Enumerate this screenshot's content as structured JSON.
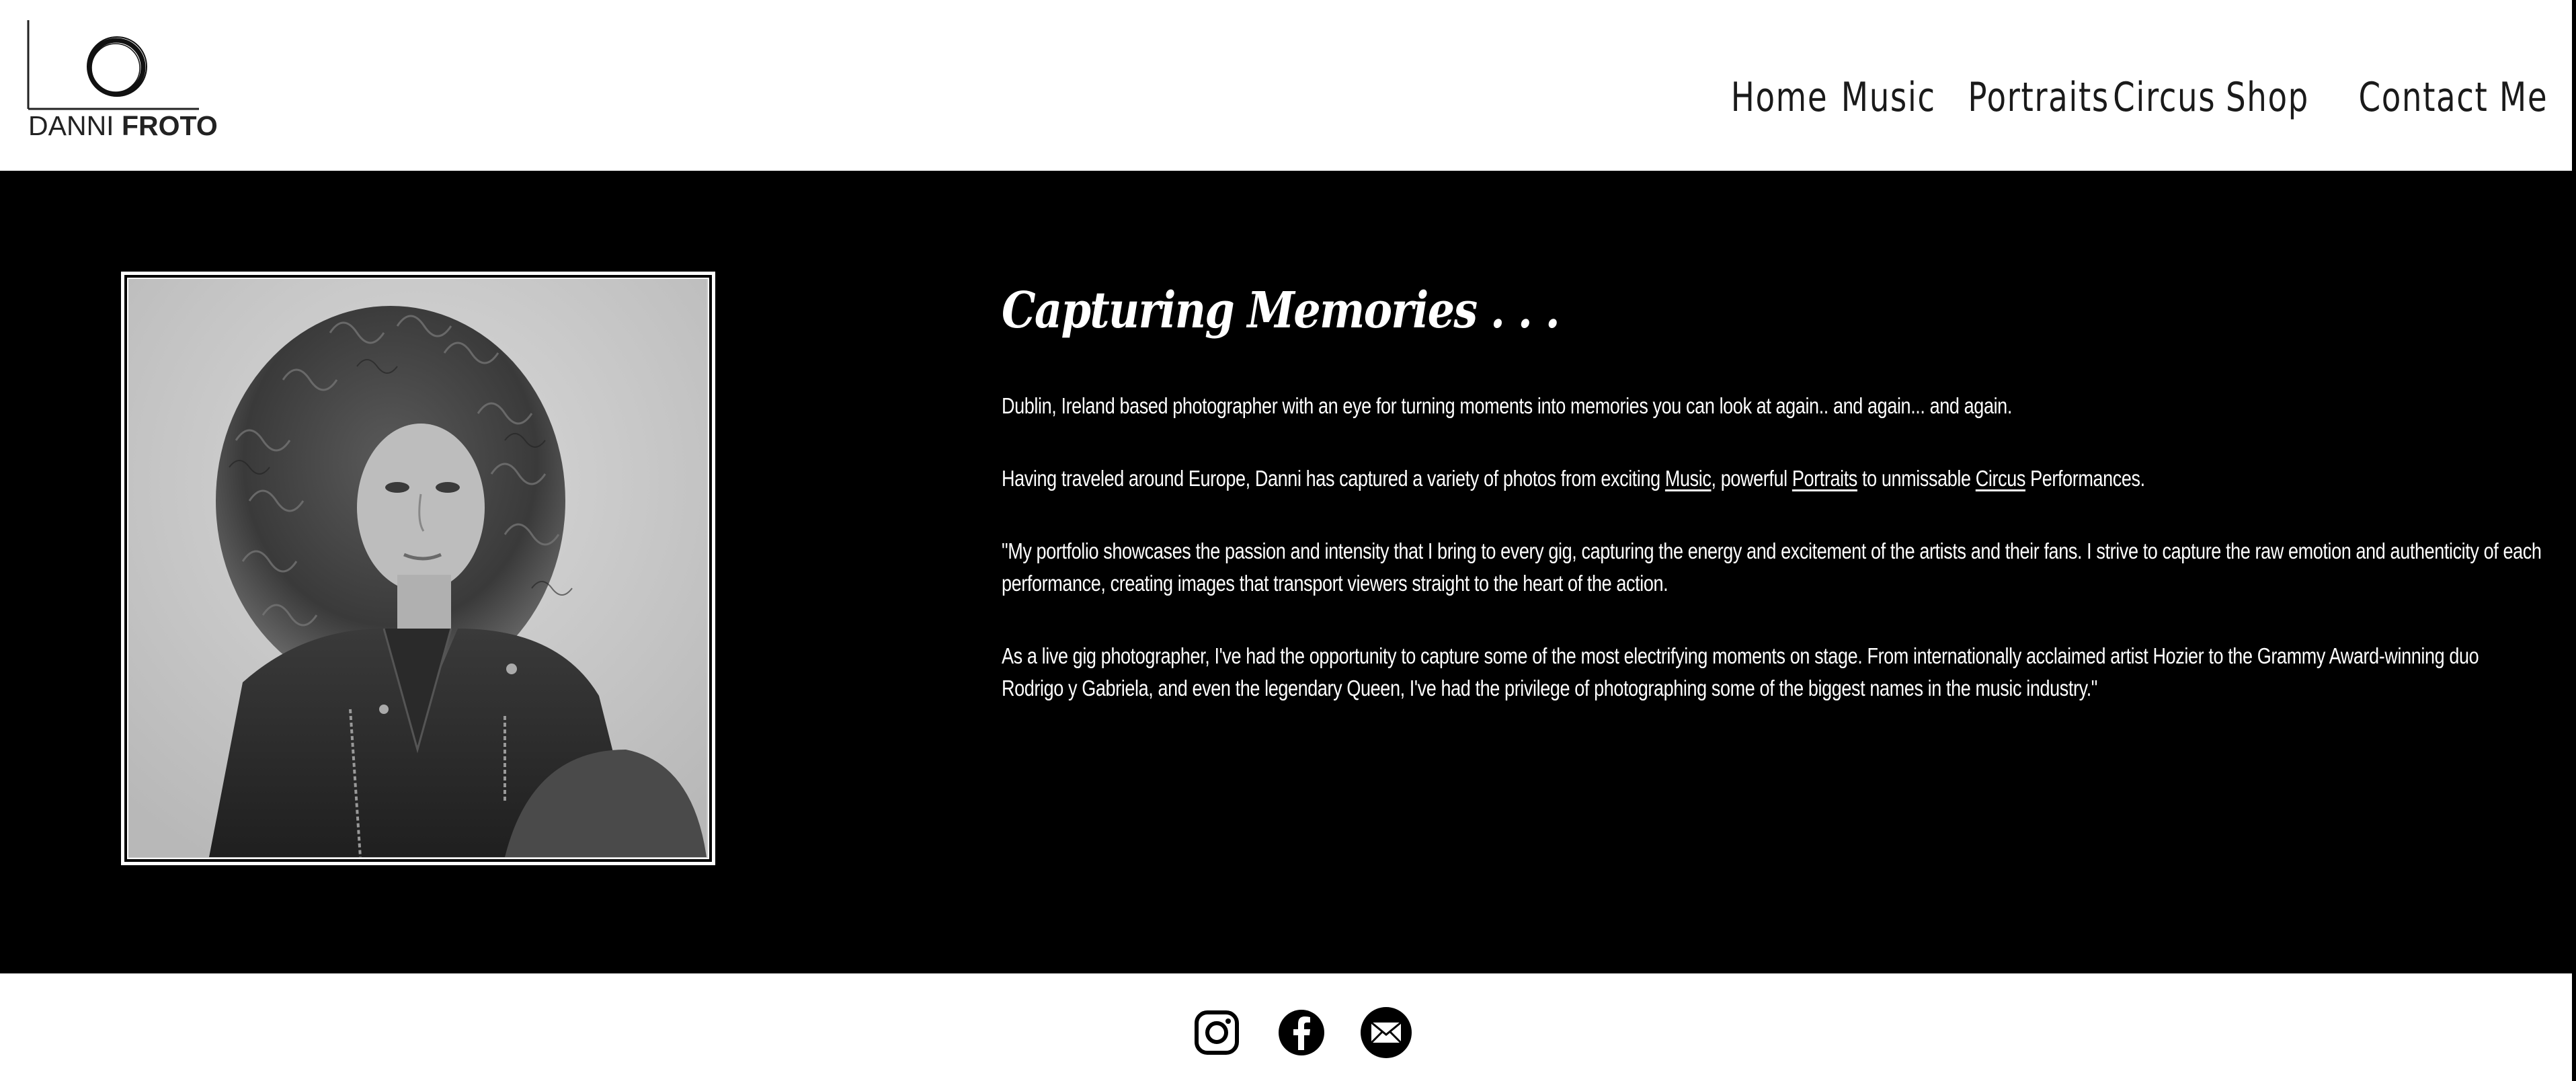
{
  "logo": {
    "text_light": "DANNI ",
    "text_bold": "FROTO"
  },
  "nav": {
    "items": [
      {
        "label": "Home"
      },
      {
        "label": "Music"
      },
      {
        "label": "Portraits"
      },
      {
        "label": "Circus"
      },
      {
        "label": "Shop"
      },
      {
        "label": "Contact Me"
      }
    ]
  },
  "hero": {
    "headline": "Capturing Memories . . .",
    "p1": "Dublin, Ireland based photographer with an eye for turning moments into memories you can look at again.. and again... and again.",
    "p2": {
      "before_music": "Having traveled around Europe, Danni has captured a variety of photos from exciting ",
      "music_link": "Music",
      "between_1": ", powerful ",
      "portraits_link": "Portraits",
      "between_2": " to unmissable ",
      "circus_link": "Circus",
      "after": " Performances."
    },
    "p3": "\"My portfolio showcases the passion and intensity that I bring to every gig, capturing the energy and excitement of the artists and their fans. I strive to capture the raw emotion and authenticity of each performance, creating images that transport viewers straight to the heart of the action.",
    "p4": "As a live gig photographer, I've had the opportunity to capture some of the most electrifying moments on stage. From internationally acclaimed artist Hozier to the Grammy Award-winning duo Rodrigo y Gabriela, and even the legendary Queen, I've had the privilege of photographing some of the biggest names in the music industry.\""
  },
  "footer": {
    "icons": [
      "instagram-icon",
      "facebook-icon",
      "email-icon"
    ]
  },
  "colors": {
    "hero_background": "#000000",
    "header_background": "#ffffff",
    "text_light": "#ffffff",
    "text_dark": "#1a1a1a"
  }
}
